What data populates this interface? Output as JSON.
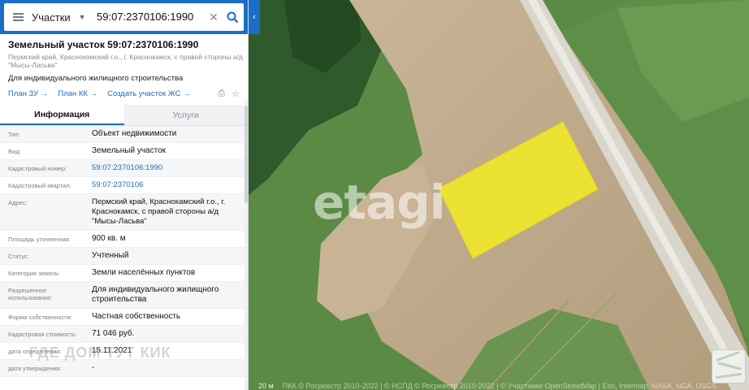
{
  "search": {
    "layer_label": "Участки",
    "query": "59:07:2370106:1990"
  },
  "card": {
    "title": "Земельный участок 59:07:2370106:1990",
    "address_short": "Пермский край, Краснокамский г.о., г. Краснокамск, с правой стороны а/д \"Мысы-Ласьва\"",
    "purpose": "Для индивидуального жилищного строительства",
    "links": [
      {
        "label": "План ЗУ →"
      },
      {
        "label": "План КК →"
      },
      {
        "label": "Создать участок ЖС →"
      }
    ]
  },
  "tabs": [
    {
      "label": "Информация",
      "active": true
    },
    {
      "label": "Услуги",
      "active": false
    }
  ],
  "info_rows": [
    {
      "label": "Тип:",
      "value": "Объект недвижимости"
    },
    {
      "label": "Вид:",
      "value": "Земельный участок"
    },
    {
      "label": "Кадастровый номер:",
      "value": "59:07:2370106:1990",
      "link": true
    },
    {
      "label": "Кадастровый квартал:",
      "value": "59:07:2370106",
      "link": true
    },
    {
      "label": "Адрес:",
      "value": "Пермский край, Краснокамский г.о., г. Краснокамск, с правой стороны а/д \"Мысы-Ласьва\""
    },
    {
      "label": "Площадь уточненная:",
      "value": "900 кв. м"
    },
    {
      "label": "Статус:",
      "value": "Учтенный"
    },
    {
      "label": "Категория земель:",
      "value": "Земли населённых пунктов"
    },
    {
      "label": "Разрешенное использование:",
      "value": "Для индивидуального жилищного строительства"
    },
    {
      "label": "Форма собственности:",
      "value": "Частная собственность"
    },
    {
      "label": "Кадастровая стоимость:",
      "value": "71 046 руб."
    },
    {
      "label": "дата определения:",
      "value": "15.11.2021"
    },
    {
      "label": "дата утверждения:",
      "value": "-"
    }
  ],
  "map": {
    "watermark": "etagi",
    "scale": "20 м",
    "attribution": "ПКК © Росреестр 2010-2022 | © НСПД © Росреестр 2010-2022 | © Участники OpenStreetMap | Esri, Intermap, NASA, NGA, USGS",
    "parcel_color": "#f1e829",
    "dom_watermark": "ГДЕ ДОМ ТУТ КИК"
  }
}
